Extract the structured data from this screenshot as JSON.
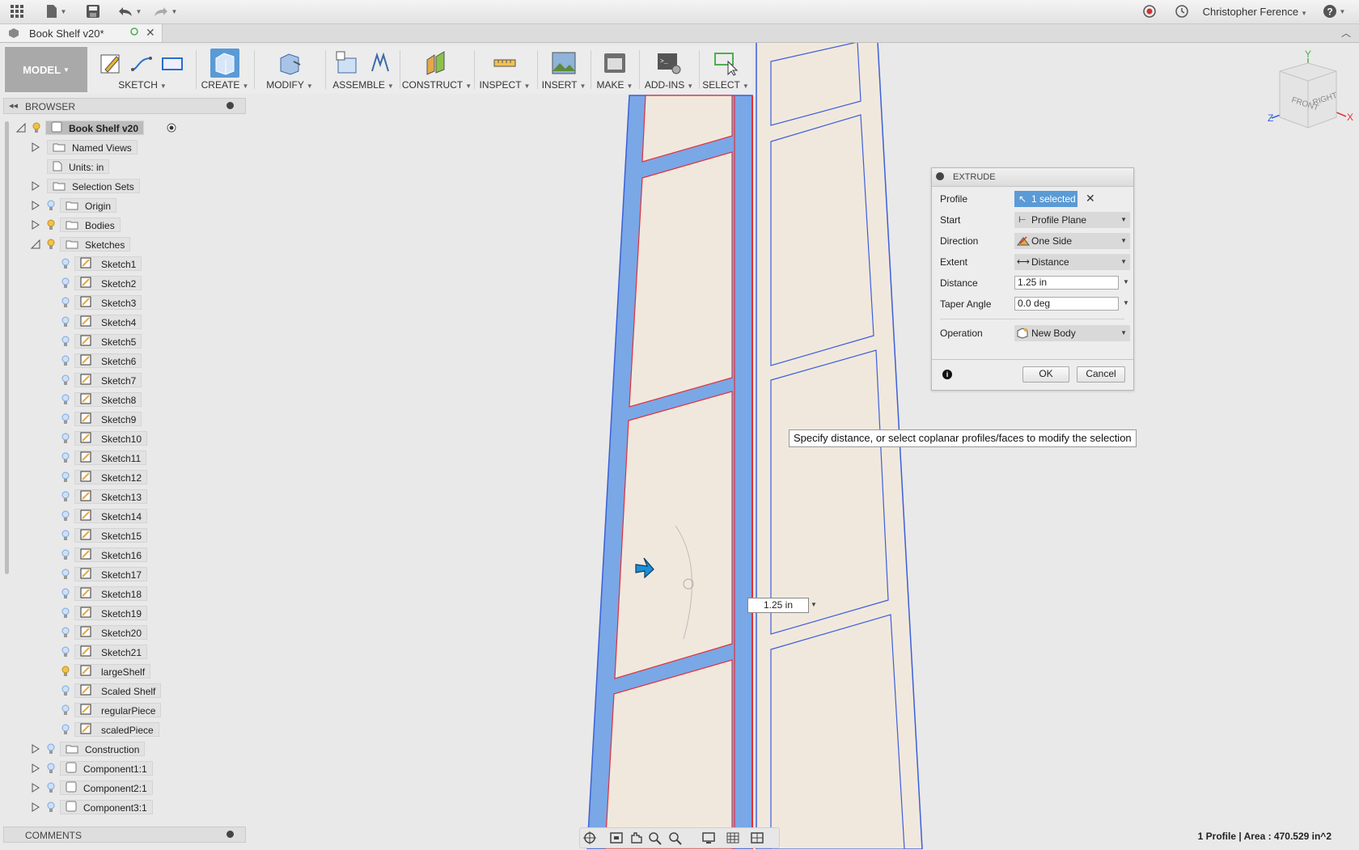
{
  "app": {
    "user_name": "Christopher Ference"
  },
  "tab": {
    "title": "Book Shelf v20*"
  },
  "toolbar": {
    "model_label": "MODEL",
    "groups": [
      "SKETCH",
      "CREATE",
      "MODIFY",
      "ASSEMBLE",
      "CONSTRUCT",
      "INSPECT",
      "INSERT",
      "MAKE",
      "ADD-INS",
      "SELECT"
    ]
  },
  "browser": {
    "title": "BROWSER",
    "root": "Book Shelf v20",
    "nodes": [
      "Named Views",
      "Units: in",
      "Selection Sets",
      "Origin",
      "Bodies",
      "Sketches"
    ],
    "sketches": [
      "Sketch1",
      "Sketch2",
      "Sketch3",
      "Sketch4",
      "Sketch5",
      "Sketch6",
      "Sketch7",
      "Sketch8",
      "Sketch9",
      "Sketch10",
      "Sketch11",
      "Sketch12",
      "Sketch13",
      "Sketch14",
      "Sketch15",
      "Sketch16",
      "Sketch17",
      "Sketch18",
      "Sketch19",
      "Sketch20",
      "Sketch21",
      "largeShelf",
      "Scaled Shelf",
      "regularPiece",
      "scaledPiece"
    ],
    "bottom_nodes": [
      "Construction",
      "Component1:1",
      "Component2:1",
      "Component3:1"
    ]
  },
  "comments": {
    "title": "COMMENTS"
  },
  "viewcube": {
    "front": "FRONT",
    "right": "RIGHT",
    "x": "X",
    "y": "Y",
    "z": "Z"
  },
  "extrude": {
    "title": "EXTRUDE",
    "profile_label": "Profile",
    "profile_value": "1 selected",
    "start_label": "Start",
    "start_value": "Profile Plane",
    "direction_label": "Direction",
    "direction_value": "One Side",
    "extent_label": "Extent",
    "extent_value": "Distance",
    "distance_label": "Distance",
    "distance_value": "1.25 in",
    "taper_label": "Taper Angle",
    "taper_value": "0.0 deg",
    "operation_label": "Operation",
    "operation_value": "New Body",
    "ok_label": "OK",
    "cancel_label": "Cancel"
  },
  "tooltip": "Specify distance, or select coplanar profiles/faces to modify the selection",
  "canvas": {
    "distance_input": "1.25 in"
  },
  "status": "1 Profile | Area : 470.529 in^2",
  "colors": {
    "accent": "#5a9ad6",
    "selected_face": "#7aa7e6",
    "panel_fill": "#f1e8dd",
    "edge_blue": "#3b5fd9",
    "edge_red": "#e0303a"
  }
}
